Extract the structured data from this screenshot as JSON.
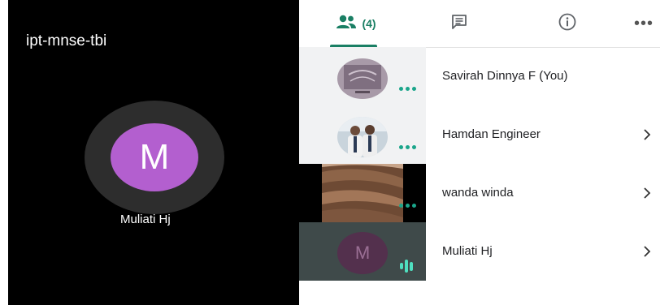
{
  "stage": {
    "meeting_code": "ipt-mnse-tbi",
    "active_speaker": {
      "initial": "M",
      "name": "Muliati Hj"
    }
  },
  "tabs": {
    "people_count": "(4)",
    "more_label": "•••"
  },
  "participants": [
    {
      "name": "Savirah Dinnya F (You)",
      "has_chevron": false,
      "status": "more-options"
    },
    {
      "name": "Hamdan Engineer",
      "has_chevron": true,
      "status": "more-options"
    },
    {
      "name": "wanda winda",
      "has_chevron": true,
      "status": "more-options"
    },
    {
      "name": "Muliati Hj",
      "initial": "M",
      "has_chevron": true,
      "status": "speaking"
    }
  ],
  "colors": {
    "accent": "#1a7f64",
    "dots": "#1aa58a",
    "speaking": "#4fe0c0",
    "speaker_avatar": "#b35fcf"
  }
}
